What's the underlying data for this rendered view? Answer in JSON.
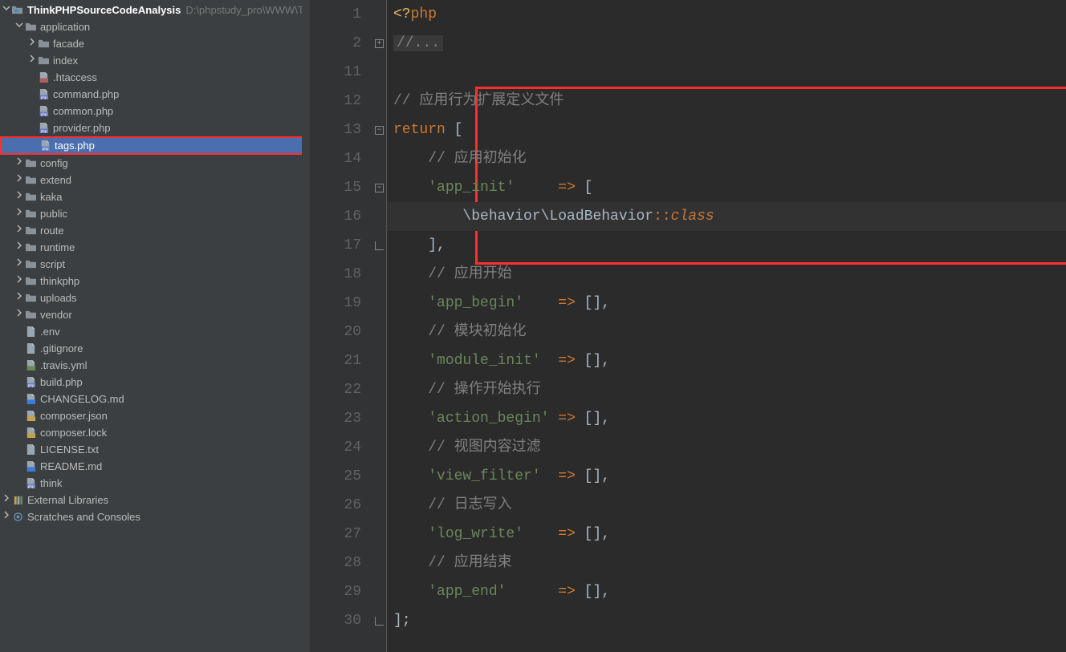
{
  "project": {
    "name": "ThinkPHPSourceCodeAnalysis",
    "path": "D:\\phpstudy_pro\\WWW\\Th"
  },
  "tree": [
    {
      "indent": 0,
      "type": "module",
      "expanded": true,
      "name": "ThinkPHPSourceCodeAnalysis",
      "pathExtra": "D:\\phpstudy_pro\\WWW\\Th"
    },
    {
      "indent": 1,
      "type": "folder",
      "expanded": true,
      "name": "application"
    },
    {
      "indent": 2,
      "type": "folder",
      "expanded": false,
      "name": "facade"
    },
    {
      "indent": 2,
      "type": "folder",
      "expanded": false,
      "name": "index"
    },
    {
      "indent": 2,
      "type": "file",
      "icon": "htaccess",
      "name": ".htaccess"
    },
    {
      "indent": 2,
      "type": "file",
      "icon": "php",
      "name": "command.php"
    },
    {
      "indent": 2,
      "type": "file",
      "icon": "php",
      "name": "common.php"
    },
    {
      "indent": 2,
      "type": "file",
      "icon": "php",
      "name": "provider.php"
    },
    {
      "indent": 2,
      "type": "file",
      "icon": "php",
      "name": "tags.php",
      "selected": true,
      "highlighted": true
    },
    {
      "indent": 1,
      "type": "folder",
      "expanded": false,
      "name": "config"
    },
    {
      "indent": 1,
      "type": "folder",
      "expanded": false,
      "name": "extend"
    },
    {
      "indent": 1,
      "type": "folder",
      "expanded": false,
      "name": "kaka"
    },
    {
      "indent": 1,
      "type": "folder",
      "expanded": false,
      "name": "public"
    },
    {
      "indent": 1,
      "type": "folder",
      "expanded": false,
      "name": "route"
    },
    {
      "indent": 1,
      "type": "folder",
      "expanded": false,
      "name": "runtime"
    },
    {
      "indent": 1,
      "type": "folder",
      "expanded": false,
      "name": "script"
    },
    {
      "indent": 1,
      "type": "folder",
      "expanded": false,
      "name": "thinkphp"
    },
    {
      "indent": 1,
      "type": "folder",
      "expanded": false,
      "name": "uploads"
    },
    {
      "indent": 1,
      "type": "folder",
      "expanded": false,
      "name": "vendor"
    },
    {
      "indent": 1,
      "type": "file",
      "icon": "text",
      "name": ".env"
    },
    {
      "indent": 1,
      "type": "file",
      "icon": "text",
      "name": ".gitignore"
    },
    {
      "indent": 1,
      "type": "file",
      "icon": "yml",
      "name": ".travis.yml"
    },
    {
      "indent": 1,
      "type": "file",
      "icon": "php",
      "name": "build.php"
    },
    {
      "indent": 1,
      "type": "file",
      "icon": "md",
      "name": "CHANGELOG.md"
    },
    {
      "indent": 1,
      "type": "file",
      "icon": "json",
      "name": "composer.json"
    },
    {
      "indent": 1,
      "type": "file",
      "icon": "json",
      "name": "composer.lock"
    },
    {
      "indent": 1,
      "type": "file",
      "icon": "text",
      "name": "LICENSE.txt"
    },
    {
      "indent": 1,
      "type": "file",
      "icon": "md",
      "name": "README.md"
    },
    {
      "indent": 1,
      "type": "file",
      "icon": "php",
      "name": "think"
    },
    {
      "indent": 0,
      "type": "lib",
      "name": "External Libraries"
    },
    {
      "indent": 0,
      "type": "scratch",
      "name": "Scratches and Consoles"
    }
  ],
  "editor": {
    "lines": [
      {
        "num": "1",
        "fold": "",
        "tokens": [
          {
            "t": "<?",
            "c": "tk-tag"
          },
          {
            "t": "php",
            "c": "tk-kw"
          }
        ]
      },
      {
        "num": "2",
        "fold": "plus",
        "tokens": [
          {
            "t": "//...",
            "c": "tk-cmt inline-bg"
          }
        ]
      },
      {
        "num": "11",
        "fold": "",
        "tokens": []
      },
      {
        "num": "12",
        "fold": "",
        "tokens": [
          {
            "t": "// 应用行为扩展定义文件",
            "c": "tk-cmt"
          }
        ]
      },
      {
        "num": "13",
        "fold": "minus",
        "tokens": [
          {
            "t": "return",
            "c": "tk-kw"
          },
          {
            "t": " [",
            "c": "tk-br"
          }
        ]
      },
      {
        "num": "14",
        "fold": "",
        "tokens": [
          {
            "t": "    ",
            "c": ""
          },
          {
            "t": "// 应用初始化",
            "c": "tk-cmt"
          }
        ]
      },
      {
        "num": "15",
        "fold": "minus",
        "tokens": [
          {
            "t": "    ",
            "c": ""
          },
          {
            "t": "'app_init'",
            "c": "tk-str"
          },
          {
            "t": "     ",
            "c": ""
          },
          {
            "t": "=>",
            "c": "tk-op"
          },
          {
            "t": " [",
            "c": "tk-br"
          }
        ]
      },
      {
        "num": "16",
        "fold": "",
        "current": true,
        "tokens": [
          {
            "t": "        ",
            "c": ""
          },
          {
            "t": "\\behavior\\LoadBehavior",
            "c": "tk-cls"
          },
          {
            "t": "::",
            "c": "tk-op"
          },
          {
            "t": "class",
            "c": "tk-const"
          }
        ]
      },
      {
        "num": "17",
        "fold": "close",
        "tokens": [
          {
            "t": "    ",
            "c": ""
          },
          {
            "t": "],",
            "c": "tk-br"
          }
        ]
      },
      {
        "num": "18",
        "fold": "",
        "tokens": [
          {
            "t": "    ",
            "c": ""
          },
          {
            "t": "// 应用开始",
            "c": "tk-cmt"
          }
        ]
      },
      {
        "num": "19",
        "fold": "",
        "tokens": [
          {
            "t": "    ",
            "c": ""
          },
          {
            "t": "'app_begin'",
            "c": "tk-str"
          },
          {
            "t": "    ",
            "c": ""
          },
          {
            "t": "=>",
            "c": "tk-op"
          },
          {
            "t": " [],",
            "c": "tk-br"
          }
        ]
      },
      {
        "num": "20",
        "fold": "",
        "tokens": [
          {
            "t": "    ",
            "c": ""
          },
          {
            "t": "// 模块初始化",
            "c": "tk-cmt"
          }
        ]
      },
      {
        "num": "21",
        "fold": "",
        "tokens": [
          {
            "t": "    ",
            "c": ""
          },
          {
            "t": "'module_init'",
            "c": "tk-str"
          },
          {
            "t": "  ",
            "c": ""
          },
          {
            "t": "=>",
            "c": "tk-op"
          },
          {
            "t": " [],",
            "c": "tk-br"
          }
        ]
      },
      {
        "num": "22",
        "fold": "",
        "tokens": [
          {
            "t": "    ",
            "c": ""
          },
          {
            "t": "// 操作开始执行",
            "c": "tk-cmt"
          }
        ]
      },
      {
        "num": "23",
        "fold": "",
        "tokens": [
          {
            "t": "    ",
            "c": ""
          },
          {
            "t": "'action_begin'",
            "c": "tk-str"
          },
          {
            "t": " ",
            "c": ""
          },
          {
            "t": "=>",
            "c": "tk-op"
          },
          {
            "t": " [],",
            "c": "tk-br"
          }
        ]
      },
      {
        "num": "24",
        "fold": "",
        "tokens": [
          {
            "t": "    ",
            "c": ""
          },
          {
            "t": "// 视图内容过滤",
            "c": "tk-cmt"
          }
        ]
      },
      {
        "num": "25",
        "fold": "",
        "tokens": [
          {
            "t": "    ",
            "c": ""
          },
          {
            "t": "'view_filter'",
            "c": "tk-str"
          },
          {
            "t": "  ",
            "c": ""
          },
          {
            "t": "=>",
            "c": "tk-op"
          },
          {
            "t": " [],",
            "c": "tk-br"
          }
        ]
      },
      {
        "num": "26",
        "fold": "",
        "tokens": [
          {
            "t": "    ",
            "c": ""
          },
          {
            "t": "// 日志写入",
            "c": "tk-cmt"
          }
        ]
      },
      {
        "num": "27",
        "fold": "",
        "tokens": [
          {
            "t": "    ",
            "c": ""
          },
          {
            "t": "'log_write'",
            "c": "tk-str"
          },
          {
            "t": "    ",
            "c": ""
          },
          {
            "t": "=>",
            "c": "tk-op"
          },
          {
            "t": " [],",
            "c": "tk-br"
          }
        ]
      },
      {
        "num": "28",
        "fold": "",
        "tokens": [
          {
            "t": "    ",
            "c": ""
          },
          {
            "t": "// 应用结束",
            "c": "tk-cmt"
          }
        ]
      },
      {
        "num": "29",
        "fold": "",
        "tokens": [
          {
            "t": "    ",
            "c": ""
          },
          {
            "t": "'app_end'",
            "c": "tk-str"
          },
          {
            "t": "      ",
            "c": ""
          },
          {
            "t": "=>",
            "c": "tk-op"
          },
          {
            "t": " [],",
            "c": "tk-br"
          }
        ]
      },
      {
        "num": "30",
        "fold": "close",
        "tokens": [
          {
            "t": "];",
            "c": "tk-br"
          }
        ]
      }
    ]
  },
  "icons": {
    "folder_fill": "#8a9299",
    "php_fill": "#6b7bbf",
    "text_fill": "#9aa7b0"
  }
}
